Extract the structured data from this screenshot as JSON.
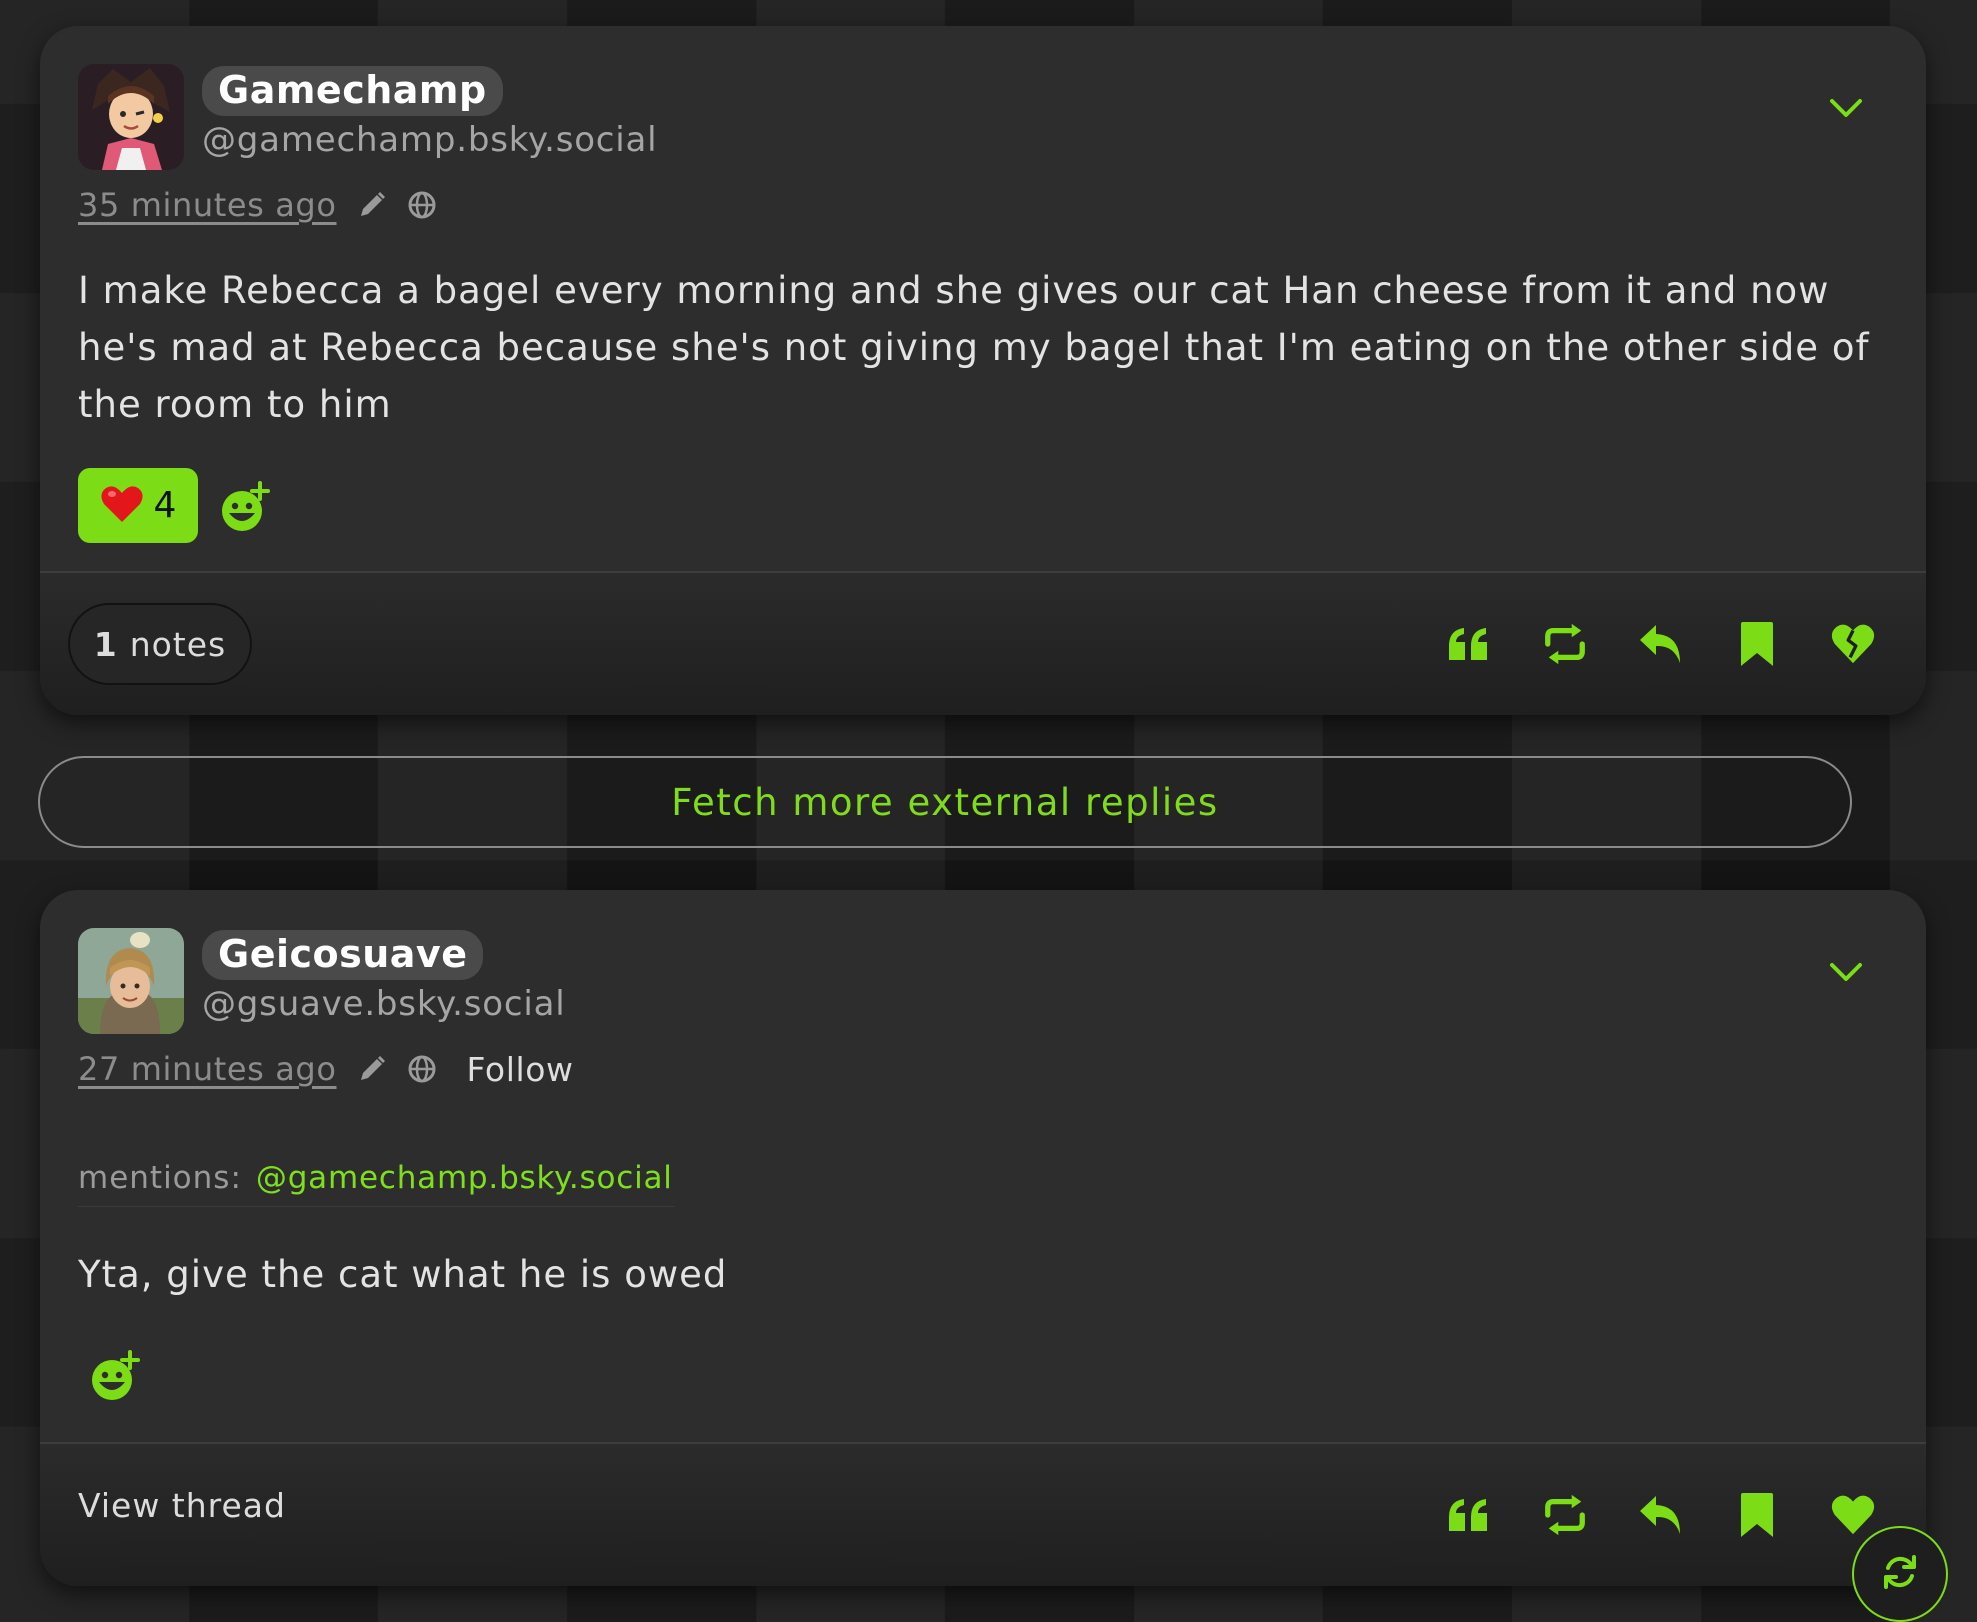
{
  "colors": {
    "accent": "#7cdd16",
    "card": "#2d2d2d",
    "background": "#141414"
  },
  "posts": [
    {
      "display_name": "Gamechamp",
      "handle": "@gamechamp.bsky.social",
      "time": "35 minutes ago",
      "text": "I make Rebecca a bagel every morning and she gives our cat Han cheese from it and now he's mad at Rebecca because she's not giving my bagel that I'm eating on the other side of the room to him",
      "reactions": [
        {
          "emoji": "❤️",
          "count": "4"
        }
      ],
      "notes": {
        "count": "1",
        "label": "notes"
      },
      "actions": [
        "quote-icon",
        "repost-icon",
        "reply-icon",
        "bookmark-icon",
        "broken-heart-icon"
      ]
    },
    {
      "display_name": "Geicosuave",
      "handle": "@gsuave.bsky.social",
      "time": "27 minutes ago",
      "follow_label": "Follow",
      "mentions_label": "mentions:",
      "mention": "@gamechamp.bsky.social",
      "text": "Yta, give the cat what he is owed",
      "view_thread": "View thread",
      "actions": [
        "quote-icon",
        "repost-icon",
        "reply-icon",
        "bookmark-icon",
        "heart-icon"
      ]
    }
  ],
  "fetch_more": "Fetch more external replies",
  "icons": {
    "edit": "pencil-icon",
    "visibility": "globe-icon",
    "menu": "chevron-down-icon",
    "add_reaction": "add-emoji-icon",
    "refresh": "refresh-icon"
  }
}
